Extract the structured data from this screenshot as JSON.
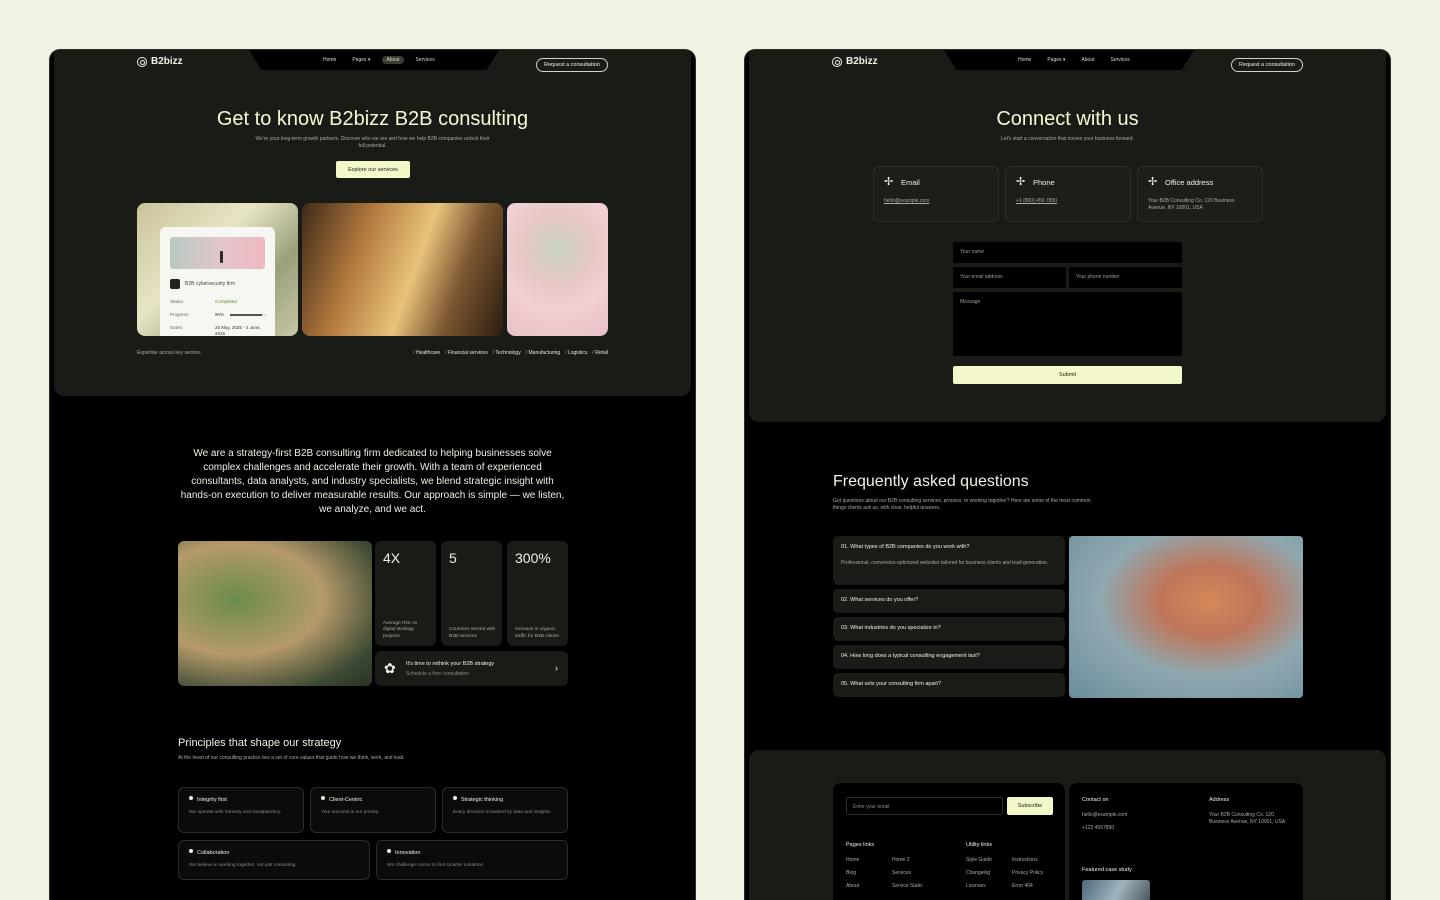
{
  "brand": "B2bizz",
  "left": {
    "nav": {
      "items": [
        "Home",
        "Pages",
        "About",
        "Services"
      ],
      "active": "About",
      "cta": "Request a consultation"
    },
    "hero": {
      "title": "Get to know B2bizz B2B consulting",
      "subtitle": "We're your long-term growth partners. Discover who we are and how we help B2B companies unlock their full potential.",
      "cta": "Explore our services"
    },
    "status_card": {
      "name": "B2B cybersecurity firm",
      "status_label": "Status:",
      "status_value": "Completed",
      "progress_label": "Progress:",
      "progress_value": "90%",
      "progress_fraction": 0.9,
      "dates_label": "Dates:",
      "dates_value": "25 May, 2025 - 3 June, 2025"
    },
    "sectors": {
      "label": "Expertise across key sectors",
      "items": [
        "Healthcare",
        "Financial services",
        "Technology",
        "Manufacturing",
        "Logistics",
        "Retail"
      ]
    },
    "intro": "We are a strategy-first B2B consulting firm dedicated to helping businesses solve complex challenges and accelerate their growth. With a team of experienced consultants, data analysts, and industry specialists, we blend strategic insight with hands-on execution to deliver measurable results. Our approach is simple — we listen, we analyze, and we act.",
    "stats": [
      {
        "value": "4X",
        "label": "Average ROI on digital strategy projects"
      },
      {
        "value": "5",
        "label": "Countries served with B2B services"
      },
      {
        "value": "300%",
        "label": "Increase in organic traffic for B2B clients"
      }
    ],
    "consult": {
      "title": "It's time to rethink your B2B strategy",
      "subtitle": "Schedule a free consultation"
    },
    "principles": {
      "title": "Principles that shape our strategy",
      "subtitle": "At the heart of our consulting practice lies a set of core values that guide how we think, work, and lead.",
      "items": [
        {
          "title": "Integrity first",
          "desc": "We operate with honesty and transparency."
        },
        {
          "title": "Client-Centric",
          "desc": "Your success is our priority."
        },
        {
          "title": "Strategic thinking",
          "desc": "Every decision is backed by data and insights."
        },
        {
          "title": "Collaboration",
          "desc": "We believe in working together, not just consulting."
        },
        {
          "title": "Innovation",
          "desc": "We challenge norms to find smarter solutions."
        }
      ]
    }
  },
  "right": {
    "nav": {
      "items": [
        "Home",
        "Pages",
        "About",
        "Services"
      ],
      "cta": "Request a consultation"
    },
    "hero": {
      "title": "Connect with us",
      "subtitle": "Let's start a conversation that moves your business forward."
    },
    "contacts": [
      {
        "label": "Email",
        "value": "hello@example.com"
      },
      {
        "label": "Phone",
        "value": "+1 (800) 456 7890"
      },
      {
        "label": "Office address",
        "value": "Your B2B Consulting Co. 120 Business Avenue, NY 10001, USA"
      }
    ],
    "form": {
      "name": "Your name",
      "email": "Your email address",
      "phone": "Your phone number",
      "message": "Message",
      "submit": "Submit"
    },
    "faq": {
      "title": "Frequently asked questions",
      "subtitle": "Got questions about our B2B consulting services, process, or working together? Here are some of the most common things clients ask us, with clear, helpful answers.",
      "items": [
        {
          "q": "01.  What types of B2B companies do you work with?",
          "a": "Professional, conversion-optimized websites tailored for business clients and lead generation."
        },
        {
          "q": "02.  What services do you offer?"
        },
        {
          "q": "03.  What industries do you specialize in?"
        },
        {
          "q": "04.  How long does a typical consulting engagement last?"
        },
        {
          "q": "05.  What sets your consulting firm apart?"
        }
      ]
    },
    "footer": {
      "email_placeholder": "Enter your email",
      "subscribe": "Subscribe",
      "pages_title": "Pages links",
      "pages_col1": [
        "Home",
        "Blog",
        "About"
      ],
      "pages_col2": [
        "Home 2",
        "Services",
        "Service Static"
      ],
      "utility_title": "Utility links",
      "utility_col1": [
        "Style Guide",
        "Changelog",
        "Licenses"
      ],
      "utility_col2": [
        "Instructions",
        "Privacy Policy",
        "Error 404"
      ],
      "contact_title": "Contact on",
      "contact_email": "hello@example.com",
      "contact_phone": "+123 4567890",
      "address_title": "Address",
      "address_value": "Your B2B Consulting Co. 120 Business Avenue, NY 10001, USA",
      "featured_title": "Featured case study"
    }
  }
}
